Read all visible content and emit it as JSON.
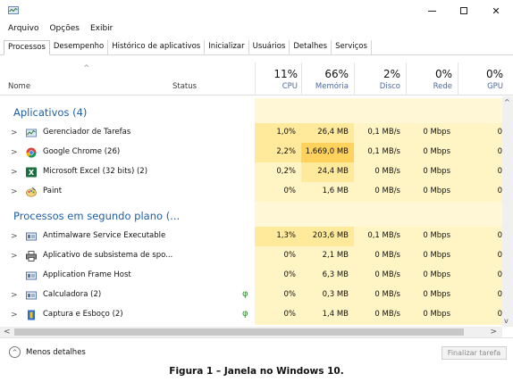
{
  "menu": [
    "Arquivo",
    "Opções",
    "Exibir"
  ],
  "tabs": [
    "Processos",
    "Desempenho",
    "Histórico de aplicativos",
    "Inicializar",
    "Usuários",
    "Detalhes",
    "Serviços"
  ],
  "header": {
    "name": "Nome",
    "status": "Status",
    "cpu_pct": "11%",
    "cpu": "CPU",
    "mem_pct": "66%",
    "mem": "Memória",
    "disk_pct": "2%",
    "disk": "Disco",
    "net_pct": "0%",
    "net": "Rede",
    "gpu_pct": "0%",
    "gpu": "GPU"
  },
  "groups": {
    "apps": "Aplicativos (4)",
    "background": "Processos em segundo plano (..."
  },
  "apps": [
    {
      "name": "Gerenciador de Tarefas",
      "cpu": "1,0%",
      "mem": "26,4 MB",
      "disk": "0,1 MB/s",
      "net": "0 Mbps",
      "gpu": "0",
      "icon": "task-manager-icon"
    },
    {
      "name": "Google Chrome (26)",
      "cpu": "2,2%",
      "mem": "1.669,0 MB",
      "disk": "0,1 MB/s",
      "net": "0 Mbps",
      "gpu": "0",
      "icon": "chrome-icon"
    },
    {
      "name": "Microsoft Excel (32 bits) (2)",
      "cpu": "0,2%",
      "mem": "24,4 MB",
      "disk": "0 MB/s",
      "net": "0 Mbps",
      "gpu": "0",
      "icon": "excel-icon"
    },
    {
      "name": "Paint",
      "cpu": "0%",
      "mem": "1,6 MB",
      "disk": "0 MB/s",
      "net": "0 Mbps",
      "gpu": "0",
      "icon": "paint-icon"
    }
  ],
  "background": [
    {
      "name": "Antimalware Service Executable",
      "cpu": "1,3%",
      "mem": "203,6 MB",
      "disk": "0,1 MB/s",
      "net": "0 Mbps",
      "gpu": "0",
      "icon": "service-icon"
    },
    {
      "name": "Aplicativo de subsistema de spo...",
      "cpu": "0%",
      "mem": "2,1 MB",
      "disk": "0 MB/s",
      "net": "0 Mbps",
      "gpu": "0",
      "icon": "printer-icon"
    },
    {
      "name": "Application Frame Host",
      "cpu": "0%",
      "mem": "6,3 MB",
      "disk": "0 MB/s",
      "net": "0 Mbps",
      "gpu": "0",
      "icon": "service-icon"
    },
    {
      "name": "Calculadora (2)",
      "cpu": "0%",
      "mem": "0,3 MB",
      "disk": "0 MB/s",
      "net": "0 Mbps",
      "gpu": "0",
      "icon": "calculator-icon"
    },
    {
      "name": "Captura e Esboço (2)",
      "cpu": "0%",
      "mem": "1,4 MB",
      "disk": "0 MB/s",
      "net": "0 Mbps",
      "gpu": "0",
      "icon": "snip-icon"
    }
  ],
  "footer": {
    "less": "Menos detalhes",
    "end_task": "Finalizar tarefa"
  },
  "caption": "Figura 1 – Janela no Windows 10.",
  "colors": {
    "shade_light": "#fff4c4",
    "shade_mid": "#ffe99b",
    "shade_hot": "#ffd25e",
    "group_text": "#1f5fa6"
  }
}
